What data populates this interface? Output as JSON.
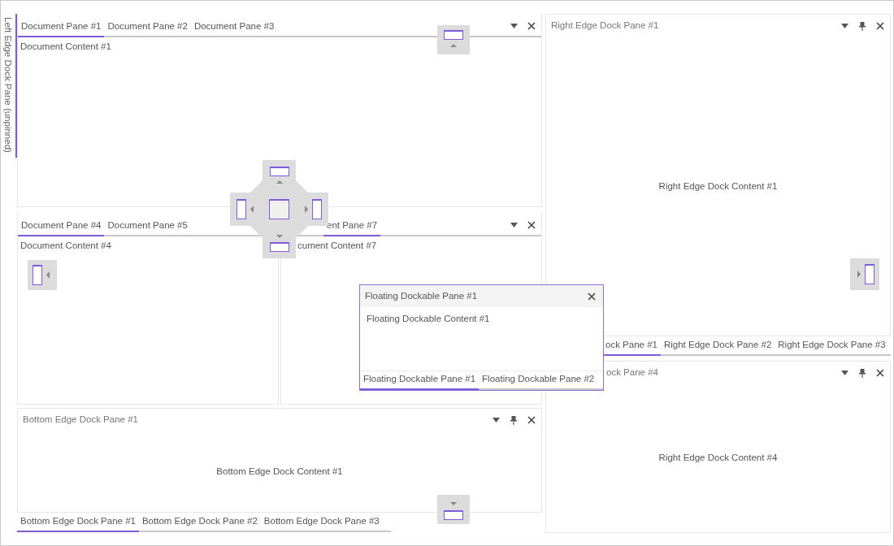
{
  "left_dock": {
    "label": "Left Edge Dock Pane (unpinned)"
  },
  "document_groups": [
    {
      "tabs": [
        {
          "label": "Document Pane #1",
          "selected": true
        },
        {
          "label": "Document Pane #2",
          "selected": false
        },
        {
          "label": "Document Pane #3",
          "selected": false
        }
      ],
      "buttons": [
        {
          "kind": "menu"
        },
        {
          "kind": "close"
        }
      ],
      "content": "Document Content #1"
    },
    {
      "tabs": [
        {
          "label": "Document Pane #4",
          "selected": true
        },
        {
          "label": "Document Pane #5",
          "selected": false
        }
      ],
      "content": "Document Content #4"
    },
    {
      "tabs": [
        {
          "label": "ent Pane #7",
          "selected": true
        }
      ],
      "buttons": [
        {
          "kind": "menu"
        },
        {
          "kind": "close"
        }
      ],
      "content": "cument Content #7"
    }
  ],
  "bottom_dock": {
    "title": "Bottom Edge Dock Pane #1",
    "buttons": [
      {
        "kind": "menu"
      },
      {
        "kind": "pin"
      },
      {
        "kind": "close"
      }
    ],
    "content": "Bottom Edge Dock Content #1",
    "tabs": [
      {
        "label": "Bottom Edge Dock Pane #1",
        "selected": true
      },
      {
        "label": "Bottom Edge Dock Pane #2",
        "selected": false
      },
      {
        "label": "Bottom Edge Dock Pane #3",
        "selected": false
      }
    ]
  },
  "right_dock": {
    "panes": [
      {
        "title": "Right Edge Dock Pane #1",
        "buttons": [
          {
            "kind": "menu"
          },
          {
            "kind": "pin"
          },
          {
            "kind": "close"
          }
        ],
        "content": "Right Edge Dock Content #1",
        "tabs": [
          {
            "label": "ock Pane #1",
            "selected": true
          },
          {
            "label": "Right Edge Dock Pane #2",
            "selected": false
          },
          {
            "label": "Right Edge Dock Pane #3",
            "selected": false
          }
        ]
      },
      {
        "title": "ock Pane #4",
        "buttons": [
          {
            "kind": "menu"
          },
          {
            "kind": "pin"
          },
          {
            "kind": "close"
          }
        ],
        "content": "Right Edge Dock Content #4"
      }
    ]
  },
  "floating_window": {
    "title": "Floating Dockable Pane #1",
    "buttons": [
      {
        "kind": "close"
      }
    ],
    "content": "Floating Dockable Content #1",
    "tabs": [
      {
        "label": "Floating Dockable Pane #1",
        "selected": true
      },
      {
        "label": "Floating Dockable Pane #2",
        "selected": false
      }
    ]
  }
}
